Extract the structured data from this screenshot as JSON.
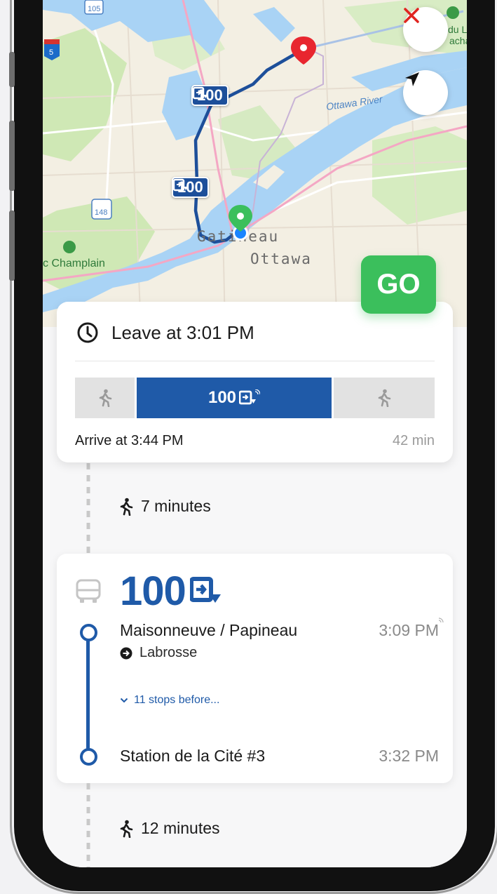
{
  "map": {
    "labels": {
      "river": "Ottawa River",
      "city_gatineau": "Gatineau",
      "city_ottawa": "Ottawa",
      "park": "c Champlain",
      "place_top_right": "du L\nacha",
      "highway_105": "105",
      "highway_5": "5",
      "highway_148": "148"
    },
    "route_badges": [
      "100",
      "100"
    ],
    "colors": {
      "route": "#1d4f9a",
      "water": "#a9d3f5",
      "park": "#cfe8b5",
      "destination_pin": "#e8262f",
      "origin_pin": "#3bbf5c",
      "current_location": "#1a84ff"
    }
  },
  "buttons": {
    "close_icon": "close-icon",
    "locate_icon": "navigation-arrow-icon",
    "go_label": "GO"
  },
  "trip": {
    "leave": "Leave at 3:01 PM",
    "route_segment": "100",
    "arrive": "Arrive at 3:44 PM",
    "duration": "42 min"
  },
  "walk_1": "7 minutes",
  "bus": {
    "number": "100",
    "board_stop": "Maisonneuve / Papineau",
    "board_time": "3:09 PM",
    "direction": "Labrosse",
    "stops_link": "11 stops before...",
    "exit_stop": "Station de la Cité #3",
    "exit_time": "3:32 PM"
  },
  "walk_2": "12 minutes",
  "accent": "#1f5aa8",
  "go_color": "#3bbf5c"
}
